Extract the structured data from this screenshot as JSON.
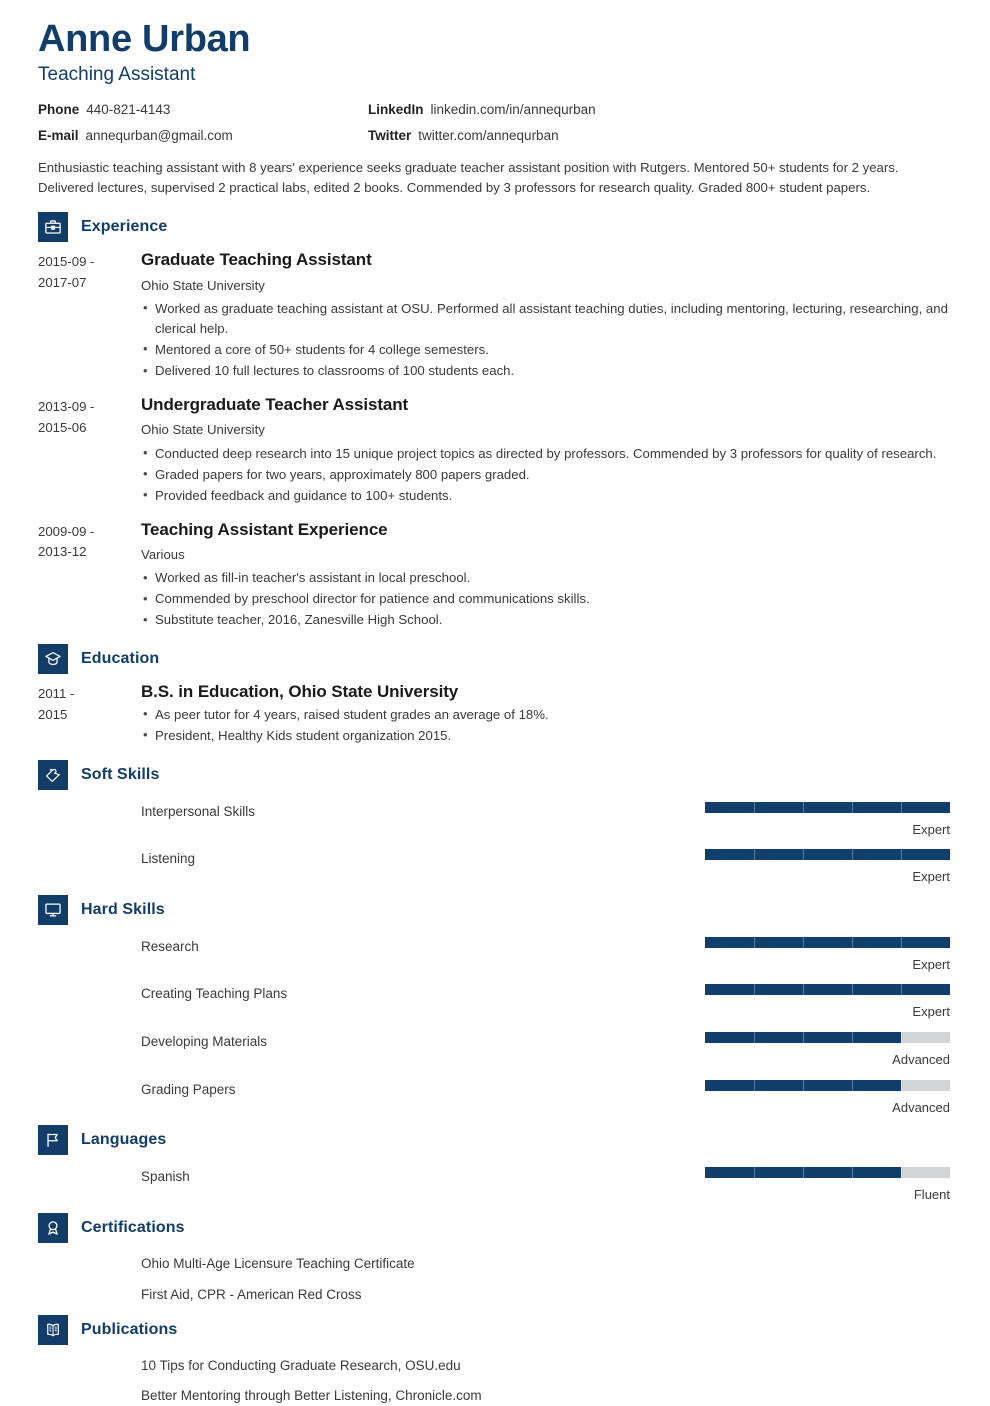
{
  "header": {
    "name": "Anne Urban",
    "job_title": "Teaching Assistant",
    "contacts": [
      {
        "label": "Phone",
        "value": "440-821-4143"
      },
      {
        "label": "LinkedIn",
        "value": "linkedin.com/in/annequrban"
      },
      {
        "label": "E-mail",
        "value": "annequrban@gmail.com"
      },
      {
        "label": "Twitter",
        "value": "twitter.com/annequrban"
      }
    ],
    "summary": "Enthusiastic teaching assistant with 8 years' experience seeks graduate teacher assistant position with Rutgers. Mentored 50+ students for 2 years. Delivered lectures, supervised 2 practical labs, edited 2 books. Commended by 3 professors for research quality. Graded 800+ student papers."
  },
  "sections": {
    "experience": {
      "title": "Experience",
      "icon": "briefcase-icon",
      "entries": [
        {
          "dates": "2015-09 - 2017-07",
          "role": "Graduate Teaching Assistant",
          "org": "Ohio State University",
          "bullets": [
            "Worked as graduate teaching assistant at OSU. Performed all assistant teaching duties, including mentoring, lecturing, researching, and clerical help.",
            "Mentored a core of 50+ students for 4 college semesters.",
            "Delivered 10 full lectures to classrooms of 100 students each."
          ]
        },
        {
          "dates": "2013-09 - 2015-06",
          "role": "Undergraduate Teacher Assistant",
          "org": "Ohio State University",
          "bullets": [
            "Conducted deep research into 15 unique project topics as directed by professors. Commended by 3 professors for quality of research.",
            "Graded papers for two years, approximately 800 papers graded.",
            "Provided feedback and guidance to 100+ students."
          ]
        },
        {
          "dates": "2009-09 - 2013-12",
          "role": "Teaching Assistant Experience",
          "org": "Various",
          "bullets": [
            "Worked as fill-in teacher's assistant in local preschool.",
            "Commended by preschool director for patience and communications skills.",
            "Substitute teacher, 2016, Zanesville High School."
          ]
        }
      ]
    },
    "education": {
      "title": "Education",
      "icon": "graduation-cap-icon",
      "entries": [
        {
          "dates": "2011 - 2015",
          "role": "B.S. in Education, Ohio State University",
          "org": "",
          "bullets": [
            "As peer tutor for 4 years, raised student grades an average of 18%.",
            "President, Healthy Kids student organization 2015."
          ]
        }
      ]
    },
    "soft_skills": {
      "title": "Soft Skills",
      "icon": "handshake-icon",
      "skills": [
        {
          "name": "Interpersonal Skills",
          "level": "Expert",
          "percent": 100
        },
        {
          "name": "Listening",
          "level": "Expert",
          "percent": 100
        }
      ]
    },
    "hard_skills": {
      "title": "Hard Skills",
      "icon": "monitor-icon",
      "skills": [
        {
          "name": "Research",
          "level": "Expert",
          "percent": 100
        },
        {
          "name": "Creating Teaching Plans",
          "level": "Expert",
          "percent": 100
        },
        {
          "name": "Developing Materials",
          "level": "Advanced",
          "percent": 80
        },
        {
          "name": "Grading Papers",
          "level": "Advanced",
          "percent": 80
        }
      ]
    },
    "languages": {
      "title": "Languages",
      "icon": "flag-icon",
      "skills": [
        {
          "name": "Spanish",
          "level": "Fluent",
          "percent": 80
        }
      ]
    },
    "certifications": {
      "title": "Certifications",
      "icon": "award-ribbon-icon",
      "items": [
        "Ohio Multi-Age Licensure Teaching Certificate",
        "First Aid, CPR - American Red Cross"
      ]
    },
    "publications": {
      "title": "Publications",
      "icon": "open-book-icon",
      "items": [
        "10 Tips for Conducting Graduate Research, OSU.edu",
        "Better Mentoring through Better Listening, Chronicle.com"
      ]
    }
  },
  "colors": {
    "accent": "#123d69",
    "meter_fill": "#103f6c",
    "meter_track": "#d3d4d6",
    "body_text": "#3a3a3a"
  }
}
